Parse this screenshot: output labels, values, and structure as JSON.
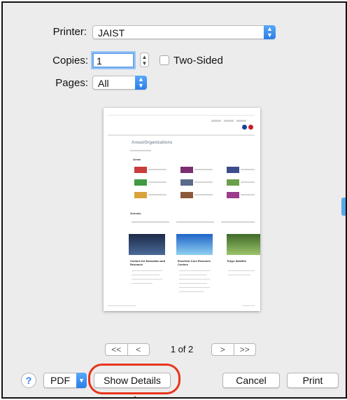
{
  "printer": {
    "label": "Printer:",
    "value": "JAIST"
  },
  "copies": {
    "label": "Copies:",
    "value": "1"
  },
  "two_sided": {
    "label": "Two-Sided",
    "checked": false
  },
  "pages": {
    "label": "Pages:",
    "value": "All"
  },
  "preview": {
    "heading": "Areas/Organizations",
    "section_areas": "Areas",
    "section_schools": "Schools",
    "block_1": "Centers for Education and Research",
    "block_2": "Excellent Core Research Centers",
    "block_3": "Tokyo Satellite"
  },
  "pager": {
    "first": "<<",
    "prev": "<",
    "page_text": "1 of 2",
    "next": ">",
    "last": ">>"
  },
  "buttons": {
    "help": "?",
    "pdf": "PDF",
    "show_details": "Show Details",
    "cancel": "Cancel",
    "print": "Print"
  },
  "colors": {
    "accent": "#2b7ee8",
    "highlight": "#e8351c",
    "dialog_bg": "#ececec"
  }
}
